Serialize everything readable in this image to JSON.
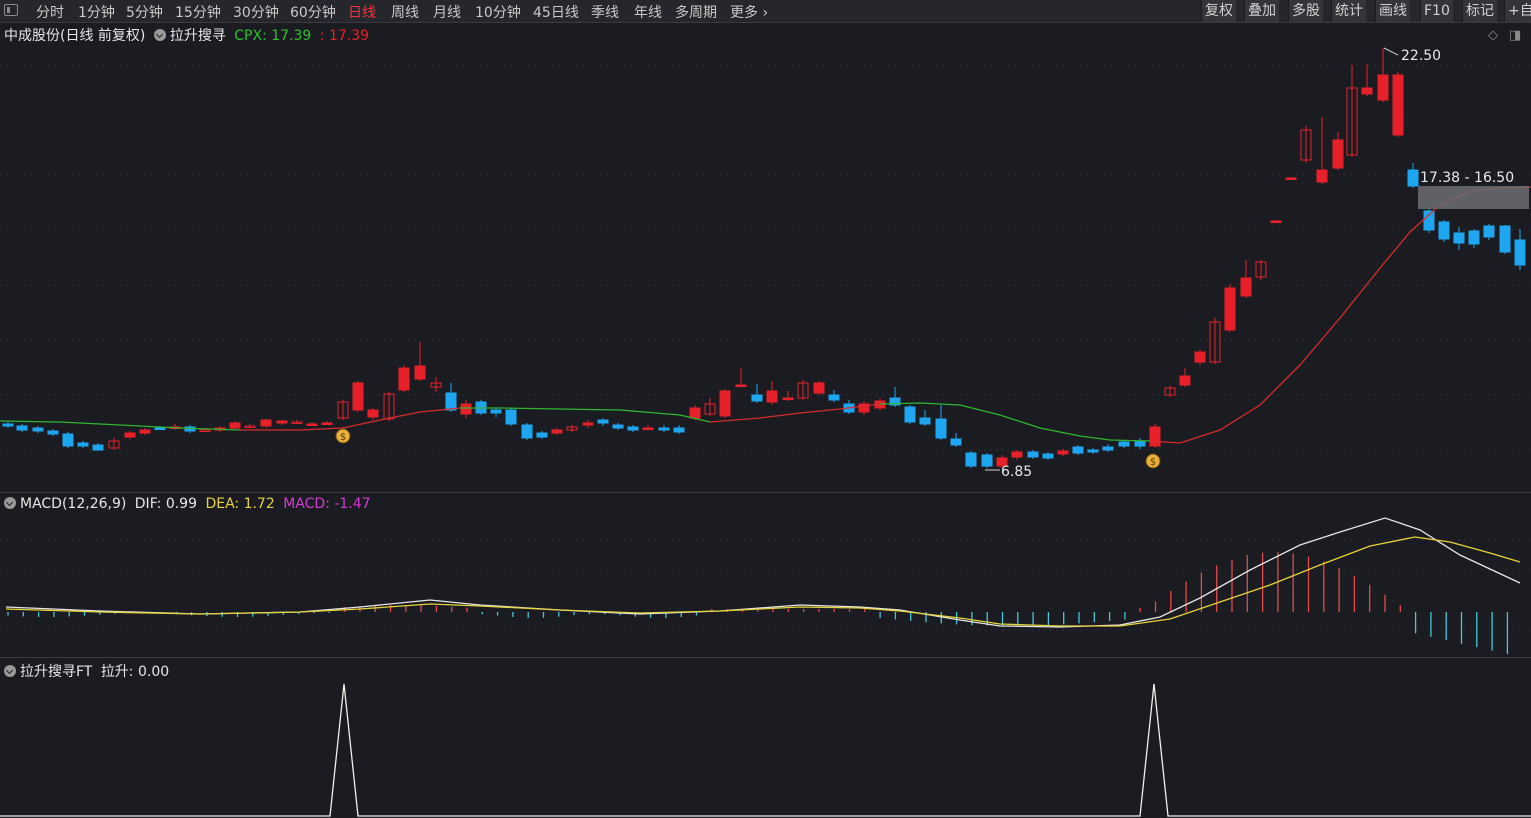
{
  "toolbar": {
    "periods": [
      "分时",
      "1分钟",
      "5分钟",
      "15分钟",
      "30分钟",
      "60分钟",
      "日线",
      "周线",
      "月线",
      "10分钟",
      "45日线",
      "季线",
      "年线",
      "多周期",
      "更多"
    ],
    "active_period": "日线",
    "more_arrow": "›",
    "right_buttons": [
      "复权",
      "叠加",
      "多股",
      "统计",
      "画线",
      "F10",
      "标记",
      "+自"
    ]
  },
  "main_pane": {
    "stock_title": "中成股份(日线 前复权)",
    "indicator_name": "拉升搜寻",
    "cpx_label": "CPX: 17.39",
    "cpx_value2": "17.39",
    "high_label": "22.50",
    "low_label": "6.85",
    "range_label": "17.38 - 16.50",
    "colors": {
      "up": "#e8202a",
      "down": "#1ea7f0",
      "ma_up": "#d62c2c",
      "ma_down": "#2fb52f",
      "signal": "#e8b23a"
    }
  },
  "macd_pane": {
    "name": "MACD(12,26,9)",
    "dif_label": "DIF: 0.99",
    "dea_label": "DEA: 1.72",
    "macd_label": "MACD: -1.47"
  },
  "lasheng_pane": {
    "name": "拉升搜寻FT",
    "value_label": "拉升: 0.00"
  },
  "chart_data": [
    {
      "type": "candlestick",
      "title": "中成股份(日线 前复权)",
      "high": 22.5,
      "low": 6.85,
      "close": 17.39,
      "annotated_range": [
        17.38,
        16.5
      ],
      "signal_markers": [
        "signal-1",
        "signal-2"
      ]
    },
    {
      "type": "line",
      "title": "MACD(12,26,9)",
      "series": [
        {
          "name": "DIF",
          "last": 0.99
        },
        {
          "name": "DEA",
          "last": 1.72
        },
        {
          "name": "MACD",
          "last": -1.47
        }
      ]
    },
    {
      "type": "line",
      "title": "拉升搜寻FT",
      "series": [
        {
          "name": "拉升",
          "last": 0.0
        }
      ],
      "spike_count": 2
    }
  ]
}
